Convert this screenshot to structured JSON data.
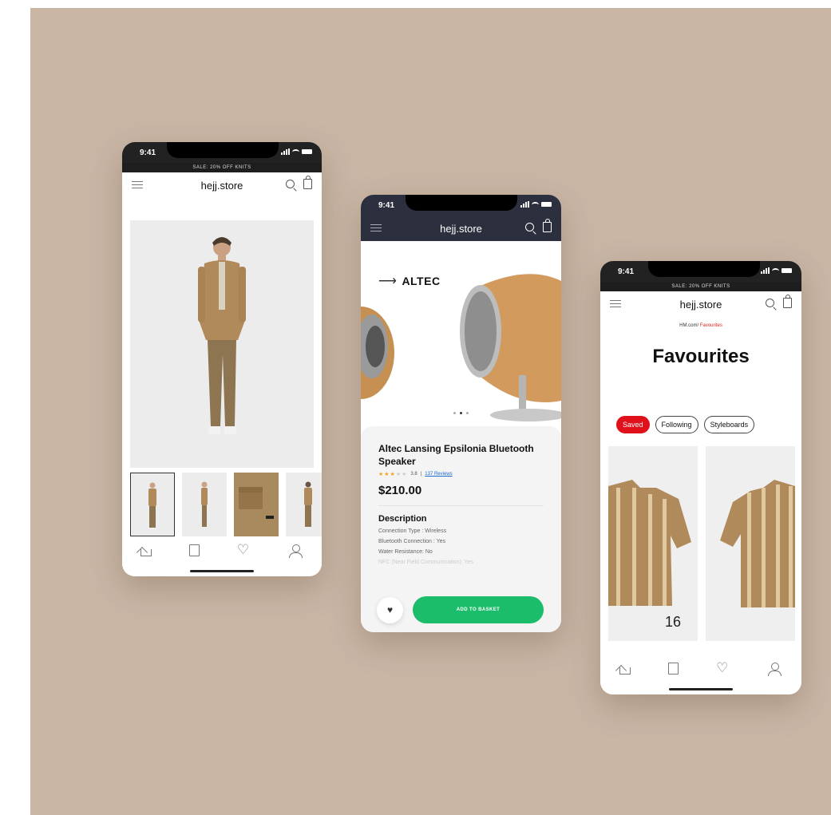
{
  "common": {
    "time": "9:41",
    "promo": "SALE: 20% OFF KNITS",
    "brand": "hejj.store"
  },
  "phone2": {
    "product_title": "Altec Lansing Epsilonia Bluetooth Speaker",
    "rating_value": "3.8",
    "rating_sep": "|",
    "reviews": "137 Reviews",
    "price": "$210.00",
    "description_title": "Description",
    "specs": [
      "Connection Type : Wireless",
      "Bluetooth Connection : Yes",
      "Water Resistance: No",
      "NFC (Near Field Communication): Yes"
    ],
    "brand_logo": "ALTEC",
    "add_button": "ADD TO BASKET"
  },
  "phone3": {
    "breadcrumb_root": "HM.com/",
    "breadcrumb_current": "Favourites",
    "title": "Favourites",
    "tabs": [
      "Saved",
      "Following",
      "Styleboards"
    ],
    "count": "16"
  },
  "colors": {
    "background": "#c9b6a5",
    "accent_green": "#1bbd6b",
    "accent_red": "#e0111b",
    "jacket": "#b08a5a"
  }
}
